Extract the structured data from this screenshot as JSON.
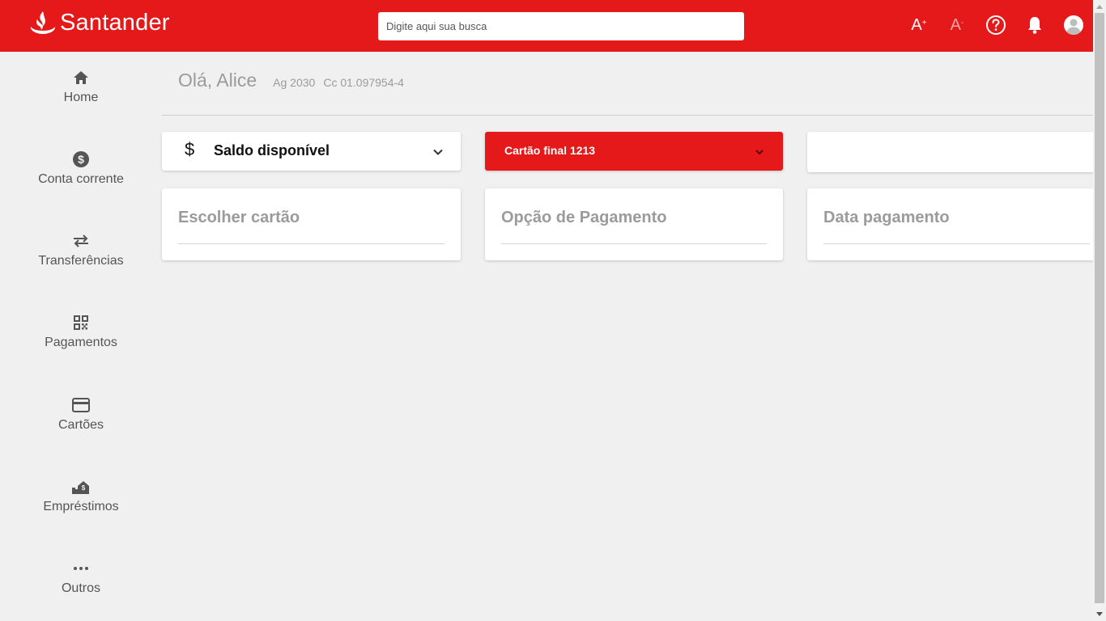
{
  "header": {
    "brand": "Santander",
    "search_placeholder": "Digite aqui sua busca",
    "font_increase": "A",
    "font_increase_sign": "+",
    "font_decrease": "A",
    "font_decrease_sign": "-"
  },
  "sidebar": {
    "items": [
      {
        "label": "Home",
        "icon": "home-icon"
      },
      {
        "label": "Conta corrente",
        "icon": "dollar-circle-icon"
      },
      {
        "label": "Transferências",
        "icon": "transfer-arrows-icon"
      },
      {
        "label": "Pagamentos",
        "icon": "qr-code-icon"
      },
      {
        "label": "Cartões",
        "icon": "credit-card-icon"
      },
      {
        "label": "Empréstimos",
        "icon": "loan-icon"
      },
      {
        "label": "Outros",
        "icon": "more-dots-icon"
      }
    ]
  },
  "greeting": {
    "name": "Olá, Alice",
    "agency": "Ag 2030",
    "account": "Cc 01.097954-4"
  },
  "dropdowns": {
    "saldo": {
      "symbol": "$",
      "label": "Saldo disponível"
    },
    "cartao": {
      "label": "Cartão final 1213"
    }
  },
  "fields": {
    "cartao": "Escolher cartão",
    "opcao": "Opção de Pagamento",
    "data": "Data pagamento"
  },
  "colors": {
    "brand_red": "#e51919",
    "text_gray": "#9b9b9b",
    "background": "#f0f0f0"
  }
}
